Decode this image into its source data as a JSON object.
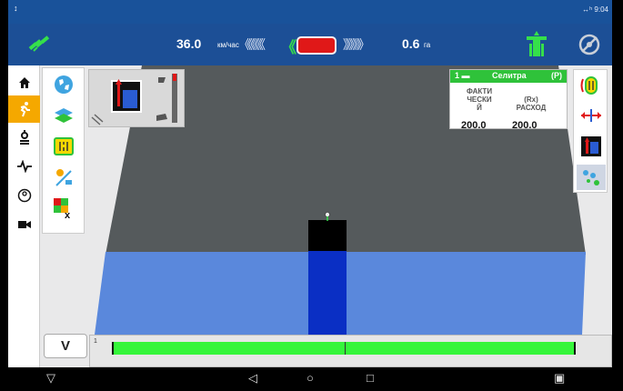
{
  "status_bar": {
    "clock": "9:04"
  },
  "top_bar": {
    "speed_value": "36.0",
    "speed_unit": "км/час",
    "area_value": "0.6",
    "area_unit": "га",
    "left_chevrons": "《《《《《",
    "right_chevrons": "》》》》》",
    "green_chevron": "《"
  },
  "boom": {
    "label": "V",
    "section_number": "1",
    "coverage_fraction": 1.0
  },
  "product": {
    "number": "1",
    "name": "Селитра",
    "mode": "(P)",
    "actual_label": "ФАКТИ\nЧЕСКИ\nЙ",
    "rx_label": "(Rx)\nРАСХОД",
    "actual_value": "200.0",
    "rx_value": "200.0"
  },
  "colors": {
    "topbar": "#1c4f96",
    "field_blue": "#5a88dc",
    "boom_red": "#e01818",
    "coverage_green": "#35f53a",
    "active_nav": "#f5a800"
  }
}
